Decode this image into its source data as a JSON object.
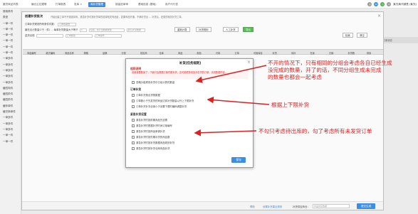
{
  "top_tabs": [
    "搬货商品列表",
    "编仓云拉跟等",
    "打单报表",
    "发库 >",
    "商补货管理",
    "销量选单审",
    "基础信息 (基础)",
    "用户代行查"
  ],
  "user": {
    "badge": "99",
    "name": "紫光商代销售 (紫光)"
  },
  "sidebar": {
    "items": [
      "搜索条件",
      "类型",
      "一单一件",
      "一单一件",
      "一单一件",
      "一单一件",
      "一单一件",
      "一单一件",
      "一单多件",
      "一单多件",
      "一单多件",
      "一单多件",
      "一单多件",
      "缓四特件",
      "缓四阶件",
      "缓四阶件",
      "缓年单件",
      "缓兑换单件",
      "一单多件",
      "一单多件",
      "一单多件",
      "一单一件",
      "一单一件"
    ]
  },
  "bg_columns": [
    "商品编号",
    "商品名称",
    "规格",
    "数量",
    "补货模式",
    "配货单",
    "批次",
    "库存数",
    "锁定量",
    "日配发件",
    "待补货",
    "订单日期",
    "订单状态"
  ],
  "dialog": {
    "title": "创建补货批次",
    "description": "开始创建工单不开需选择商，紧急补货可按补货单的选择相关商品处，如果商品开通，不满补货出 ... 补货后，还需的相关补货工单。",
    "close": "×",
    "row1": {
      "label": "订单补货规则所有条件件数：",
      "value": "订单各期数"
    },
    "row2": {
      "label": "最在合计数量少于（件），每单补货数量大于等于",
      "input1": "0",
      "input2": "包括，合计出数据类型",
      "input3": "默认补货数据"
    },
    "buttons": {
      "calc": "重新计算",
      "rules": "补货规则",
      "manual": "人工补货",
      "export": "导出"
    },
    "row3": {
      "label": "送货合规",
      "input1": "",
      "input2": "订单数量",
      "input3": "订单编号"
    },
    "search": "检索",
    "clear": "清空",
    "grid_headers": [
      "商品编号",
      "款式编码",
      "商品名称",
      "规格",
      "品牌",
      "分类",
      "供应商",
      "仓库",
      "商品",
      "颜色",
      "尺码",
      "订单",
      "可用库存",
      "补货",
      "待补",
      "在途",
      "日销",
      "补货数",
      "排序"
    ],
    "footer": {
      "help": "帮助",
      "mode_label": "设置补货建议规则",
      "supplier_label": "补货供应商仓：",
      "supplier_placeholder": "商品供应数据",
      "submit": "提交生成"
    }
  },
  "rules": {
    "title": "补货[任务规则]",
    "close": "×",
    "section_note": "相同说明",
    "warning": "设置首要数量了，下面只会根据订单件数补货，这可能很多将会存在货的订单，请将数据内容...",
    "warning2": "",
    "opt_note": "忽略分组规则补货中已经计算的数量",
    "section_order": "订单补货",
    "order_opts": [
      "订单补货按合货物数据",
      "订单数小于先发货的商品达到补货数量以外上下限补货",
      "订单补货补充仓库小于设置下限时编码调整补货"
    ],
    "section_extra": "紧急补货设置",
    "extra_opts": [
      "紧急补货时按前期商品先设置",
      "紧急补货时根据补货时间订单编号",
      "紧急补货时按商品单调补货",
      "紧急补货时按先期补货的商品数",
      "紧急补货时按补货数据商品规则补货",
      "紧急补货时按补货仓库商品补货"
    ],
    "save": "保存"
  },
  "annotations": {
    "note1": [
      "不开的情况下，只有相同的分组会考虑各自已经生成",
      "没完成的数量，开了的话，不同分组生成未完成",
      "的数量也都会一起考虑"
    ],
    "note2": "根据上下限补货",
    "note3": "不勾只考虑待出库的，勾了考虑所有未发货订单"
  }
}
